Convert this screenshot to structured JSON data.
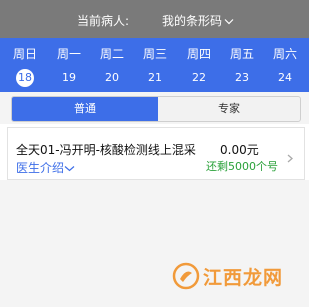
{
  "header": {
    "patient_label": "当前病人:",
    "barcode_label": "我的条形码"
  },
  "calendar": {
    "days": [
      {
        "weekday": "周日",
        "date": "18",
        "selected": true
      },
      {
        "weekday": "周一",
        "date": "19",
        "selected": false
      },
      {
        "weekday": "周二",
        "date": "20",
        "selected": false
      },
      {
        "weekday": "周三",
        "date": "21",
        "selected": false
      },
      {
        "weekday": "周四",
        "date": "22",
        "selected": false
      },
      {
        "weekday": "周五",
        "date": "23",
        "selected": false
      },
      {
        "weekday": "周六",
        "date": "24",
        "selected": false
      }
    ]
  },
  "tabs": {
    "normal": "普通",
    "expert": "专家"
  },
  "doctor_card": {
    "title": "全天01-冯开明-核酸检测线上混采",
    "price": "0.00元",
    "remaining": "还剩5000个号",
    "intro": "医生介绍"
  },
  "watermark": {
    "text": "江西龙网"
  },
  "colors": {
    "header_bg": "#7a7a7a",
    "accent": "#3d6ee8",
    "remaining_green": "#2aa13a"
  }
}
